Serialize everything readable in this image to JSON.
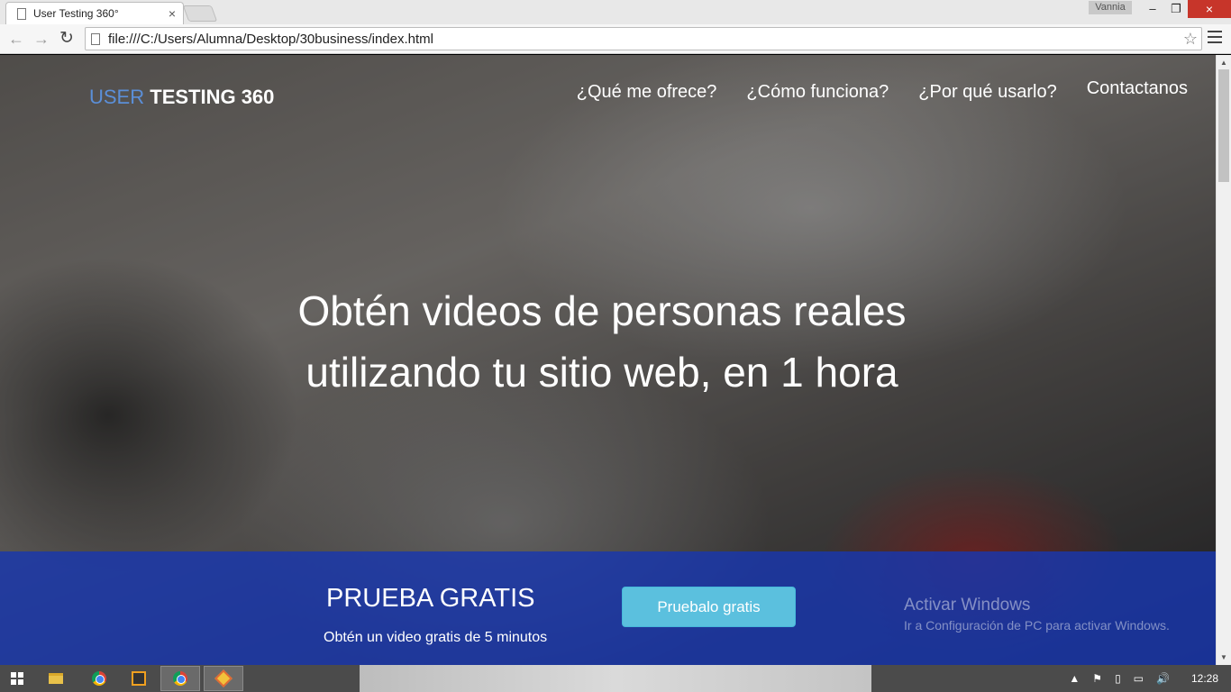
{
  "browser": {
    "tab_title": "User Testing 360°",
    "tab_close": "×",
    "user_name": "Vannia",
    "url": "file:///C:/Users/Alumna/Desktop/30business/index.html",
    "win_min": "–",
    "win_max": "❐",
    "win_close": "×",
    "back": "←",
    "forward": "→",
    "reload": "↻",
    "star": "☆"
  },
  "site": {
    "brand_part1": "USER ",
    "brand_part2": "TESTING 360",
    "nav": [
      "¿Qué me ofrece?",
      "¿Cómo funciona?",
      "¿Por qué usarlo?",
      "Contactanos"
    ],
    "headline_line1": "Obtén videos de personas reales",
    "headline_line2": "utilizando tu sitio web, en 1 hora",
    "cta_title": "PRUEBA GRATIS",
    "cta_sub": "Obtén un video gratis de 5 minutos",
    "cta_button": "Pruebalo gratis"
  },
  "watermark": {
    "line1": "Activar Windows",
    "line2": "Ir a Configuración de PC para activar Windows."
  },
  "scrollbar": {
    "up": "▲",
    "down": "▼"
  },
  "taskbar": {
    "tray_icons": [
      "▲",
      "⚑",
      "▯",
      "▭",
      "🔊"
    ],
    "clock": "12:28"
  }
}
